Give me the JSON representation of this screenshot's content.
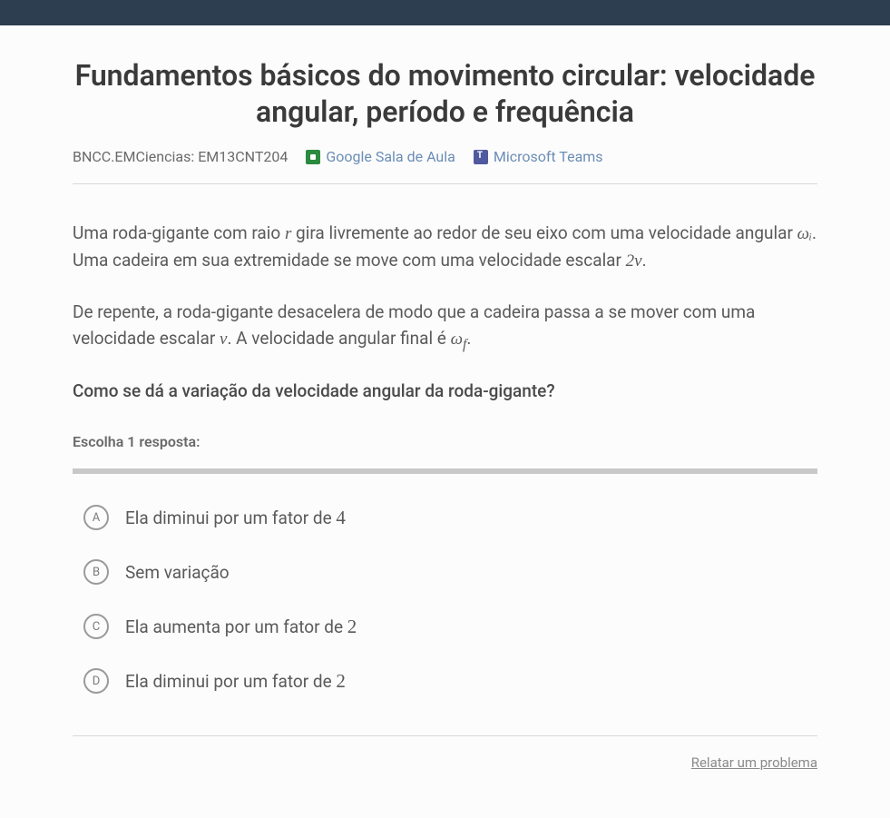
{
  "title": "Fundamentos básicos do movimento circular: velocidade angular, período e frequência",
  "bncc_label": "BNCC.EMCiencias: EM13CNT204",
  "share": {
    "google": "Google Sala de Aula",
    "teams": "Microsoft Teams"
  },
  "problem": {
    "p1_a": "Uma roda-gigante com raio ",
    "p1_var1": "r",
    "p1_b": " gira livremente ao redor de seu eixo com uma velocidade angular ",
    "p1_var2": "ωᵢ",
    "p1_c": ". Uma cadeira em sua extremidade se move com uma velocidade escalar ",
    "p1_var3": "2v",
    "p1_d": ".",
    "p2_a": "De repente, a roda-gigante desacelera de modo que a cadeira passa a se mover com uma velocidade escalar ",
    "p2_var1": "v",
    "p2_b": ". A velocidade angular final é ",
    "p2_var2": "ω",
    "p2_sub": "f",
    "p2_c": "."
  },
  "question": "Como se dá a variação da velocidade angular da roda-gigante?",
  "choose_label": "Escolha 1 resposta:",
  "answers": [
    {
      "badge": "A",
      "text_a": "Ela diminui por um fator de ",
      "num": "4",
      "text_b": ""
    },
    {
      "badge": "B",
      "text_a": "Sem variação",
      "num": "",
      "text_b": ""
    },
    {
      "badge": "C",
      "text_a": "Ela aumenta por um fator de ",
      "num": "2",
      "text_b": ""
    },
    {
      "badge": "D",
      "text_a": "Ela diminui por um fator de ",
      "num": "2",
      "text_b": ""
    }
  ],
  "report_link": "Relatar um problema"
}
